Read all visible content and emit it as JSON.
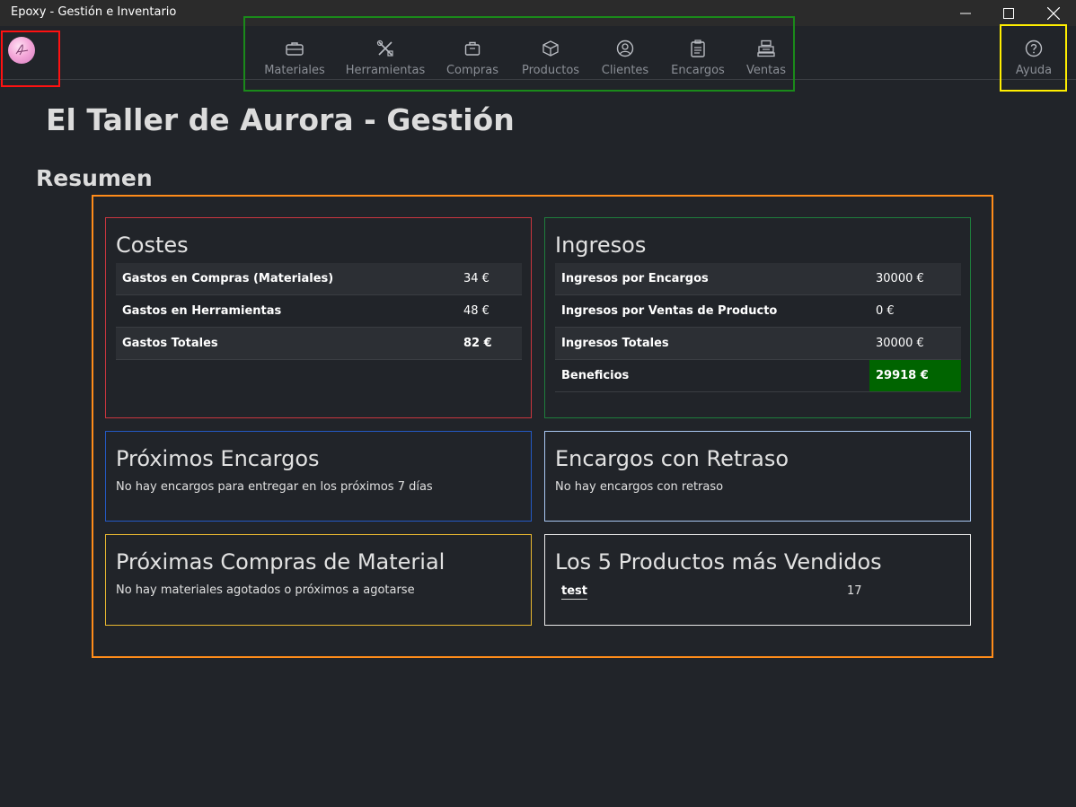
{
  "window": {
    "title": "Epoxy - Gestión e Inventario"
  },
  "nav": {
    "items": [
      {
        "label": "Materiales",
        "icon": "briefcase-icon"
      },
      {
        "label": "Herramientas",
        "icon": "tools-icon"
      },
      {
        "label": "Compras",
        "icon": "shopping-bag-icon"
      },
      {
        "label": "Productos",
        "icon": "box-icon"
      },
      {
        "label": "Clientes",
        "icon": "user-circle-icon"
      },
      {
        "label": "Encargos",
        "icon": "clipboard-icon"
      },
      {
        "label": "Ventas",
        "icon": "cash-register-icon"
      }
    ],
    "help_label": "Ayuda"
  },
  "page": {
    "title": "El Taller de Aurora - Gestión",
    "section": "Resumen"
  },
  "costs": {
    "title": "Costes",
    "rows": [
      {
        "label": "Gastos en Compras (Materiales)",
        "value": "34 €"
      },
      {
        "label": "Gastos en Herramientas",
        "value": "48 €"
      },
      {
        "label": "Gastos Totales",
        "value": "82 €"
      }
    ]
  },
  "income": {
    "title": "Ingresos",
    "rows": [
      {
        "label": "Ingresos por Encargos",
        "value": "30000 €"
      },
      {
        "label": "Ingresos por Ventas de Producto",
        "value": "0 €"
      },
      {
        "label": "Ingresos Totales",
        "value": "30000 €"
      },
      {
        "label": "Beneficios",
        "value": "29918 €"
      }
    ]
  },
  "upcoming_orders": {
    "title": "Próximos Encargos",
    "text": "No hay encargos para entregar en los próximos 7 días"
  },
  "delayed_orders": {
    "title": "Encargos con Retraso",
    "text": "No hay encargos con retraso"
  },
  "upcoming_purchases": {
    "title": "Próximas Compras de Material",
    "text": "No hay materiales agotados o próximos a agotarse"
  },
  "top_products": {
    "title": "Los 5 Productos más Vendidos",
    "items": [
      {
        "name": "test",
        "count": "17"
      }
    ]
  },
  "colors": {
    "background": "#212429",
    "costs_border": "#c9363f",
    "income_border": "#1e7d3c",
    "upcoming_orders_border": "#2459c4",
    "delayed_orders_border": "#a9c7f2",
    "upcoming_purchases_border": "#e8b830",
    "top_products_border": "#e8e8e8",
    "profit_highlight": "#006400"
  }
}
